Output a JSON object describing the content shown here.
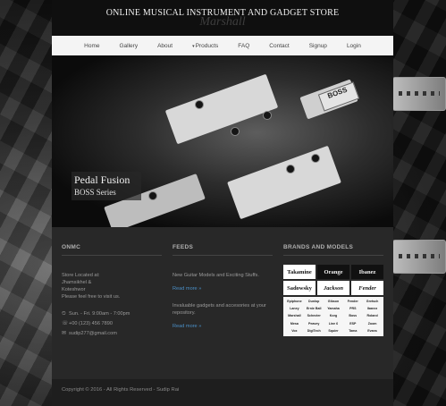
{
  "site_title": "ONLINE MUSICAL INSTRUMENT AND GADGET STORE",
  "watermark": "Marshall",
  "nav": [
    {
      "label": "Home"
    },
    {
      "label": "Gallery"
    },
    {
      "label": "About"
    },
    {
      "label": "Products",
      "has_dropdown": true
    },
    {
      "label": "FAQ"
    },
    {
      "label": "Contact"
    },
    {
      "label": "Signup"
    },
    {
      "label": "Login"
    }
  ],
  "hero": {
    "title": "Pedal Fusion",
    "subtitle": "BOSS Series",
    "pedal_label": "BOSS"
  },
  "footer": {
    "onmc": {
      "title": "ONMC",
      "lines": [
        "Store Located at:",
        "Jhamsikhel &",
        "Koteshwor",
        "Please feel free to visit us."
      ],
      "hours": "Sun. - Fri. 9:00am - 7:00pm",
      "phone": "+00 (123) 456 7890",
      "email": "sudip277@gmail.com"
    },
    "feeds": {
      "title": "FEEDS",
      "items": [
        {
          "text": "New Guitar Models and Exciting Stuffs.",
          "link": "Read more »"
        },
        {
          "text": "Invaluable gadgets and accesories at your repository.",
          "text_line2": "repository.",
          "link": "Read more »"
        }
      ]
    },
    "brands": {
      "title": "BRANDS AND MODELS",
      "logos": [
        "Takamine",
        "Orange",
        "Ibanez",
        "Sadowsky",
        "Jackson",
        "Fender"
      ],
      "small_logos": [
        "Epiphone",
        "Dunlop",
        "Gibson",
        "Fender",
        "Gretsch",
        "Laney",
        "Ernie Ball",
        "Yamaha",
        "PRS",
        "Ibanez",
        "Marshall",
        "Schecter",
        "Korg",
        "Boss",
        "Roland",
        "Mesa",
        "Peavey",
        "Line 6",
        "ESP",
        "Zoom",
        "Vox",
        "DigiTech",
        "Squier",
        "Tama",
        "Evans"
      ]
    }
  },
  "copyright": "Copyright © 2016 - All Rights Reserved - Sudip Rai",
  "colors": {
    "link": "#4a8fc7",
    "footer_bg": "#282828",
    "nav_bg": "#f4f4f4"
  }
}
